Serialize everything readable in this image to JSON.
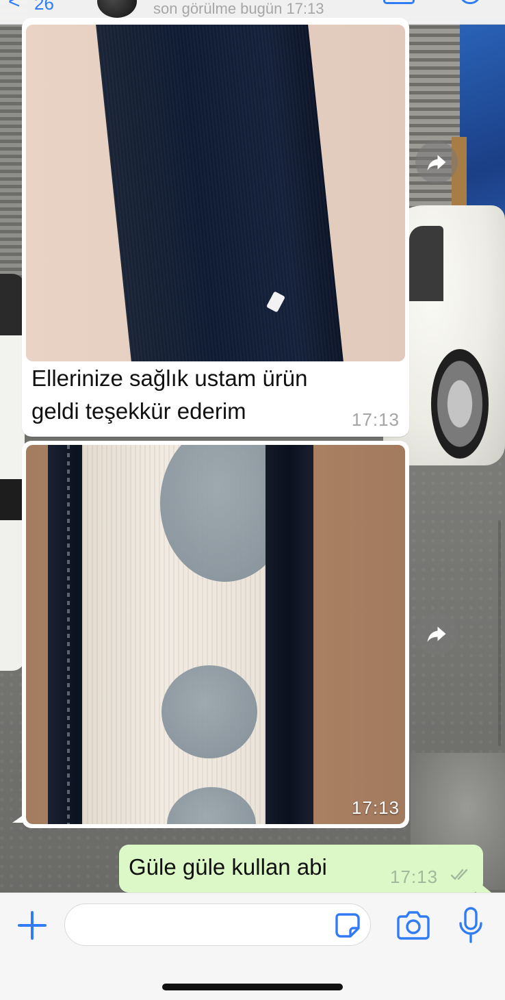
{
  "header": {
    "back_symbol": "<",
    "back_count": "26",
    "last_seen": "son görülme bugün 17:13"
  },
  "messages": [
    {
      "direction": "incoming",
      "type": "image_with_caption",
      "caption": "Ellerinize sağlık ustam ürün geldi teşekkür ederim",
      "time": "17:13"
    },
    {
      "direction": "incoming",
      "type": "image",
      "time": "17:13"
    },
    {
      "direction": "outgoing",
      "type": "text",
      "text": "Güle güle kullan abi",
      "time": "17:13",
      "status": "read"
    }
  ],
  "composer": {
    "value": "",
    "placeholder": ""
  },
  "colors": {
    "accent": "#2f7cf6",
    "outgoing_bubble": "#dcf8c6",
    "incoming_bubble": "#ffffff",
    "input_bar": "#f6f6f6"
  },
  "icons": [
    "plus-icon",
    "sticker-icon",
    "camera-icon",
    "microphone-icon",
    "forward-icon",
    "read-ticks-icon",
    "video-call-icon",
    "phone-call-icon"
  ]
}
